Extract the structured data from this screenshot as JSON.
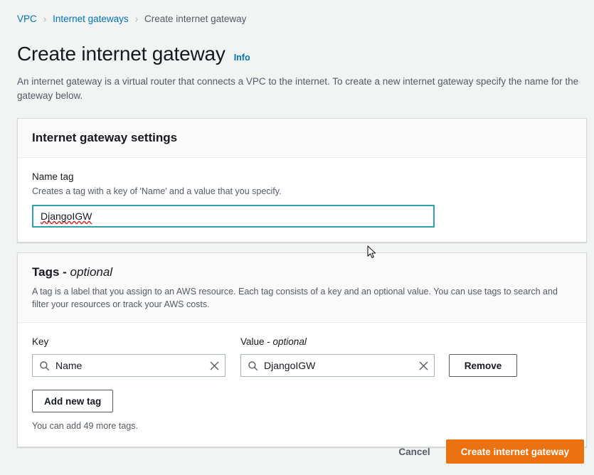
{
  "breadcrumb": {
    "separator": "›",
    "items": [
      {
        "label": "VPC",
        "current": false
      },
      {
        "label": "Internet gateways",
        "current": false
      },
      {
        "label": "Create internet gateway",
        "current": true
      }
    ]
  },
  "header": {
    "title": "Create internet gateway",
    "info_label": "Info",
    "description": "An internet gateway is a virtual router that connects a VPC to the internet. To create a new internet gateway specify the name for the gateway below."
  },
  "settings_panel": {
    "title": "Internet gateway settings",
    "name_tag": {
      "label": "Name tag",
      "hint": "Creates a tag with a key of 'Name' and a value that you specify.",
      "value": "DjangoIGW",
      "placeholder": ""
    }
  },
  "tags_panel": {
    "title_main": "Tags",
    "title_dash": " - ",
    "title_optional": "optional",
    "description": "A tag is a label that you assign to an AWS resource. Each tag consists of a key and an optional value. You can use tags to search and filter your resources or track your AWS costs.",
    "columns": {
      "key_label": "Key",
      "value_label_main": "Value",
      "value_label_dash": " - ",
      "value_label_optional": "optional"
    },
    "rows": [
      {
        "key": "Name",
        "key_placeholder": "Enter key",
        "value": "DjangoIGW",
        "value_placeholder": "Enter value",
        "remove_label": "Remove",
        "search_icon": "search-icon",
        "clear_icon": "close-icon"
      }
    ],
    "add_tag_label": "Add new tag",
    "tags_note": "You can add 49 more tags."
  },
  "footer": {
    "cancel_label": "Cancel",
    "submit_label": "Create internet gateway"
  },
  "colors": {
    "page_background": "#f2f3f3",
    "panel_background": "#ffffff",
    "panel_header_background": "#fafafa",
    "link_blue": "#0073bb",
    "secondary_text": "#545b64",
    "primary_text": "#16191f",
    "focus_border_teal": "#2ea1b0",
    "primary_button_orange": "#ec7211",
    "spellcheck_red": "#e02020",
    "input_border": "#aab7b8"
  }
}
